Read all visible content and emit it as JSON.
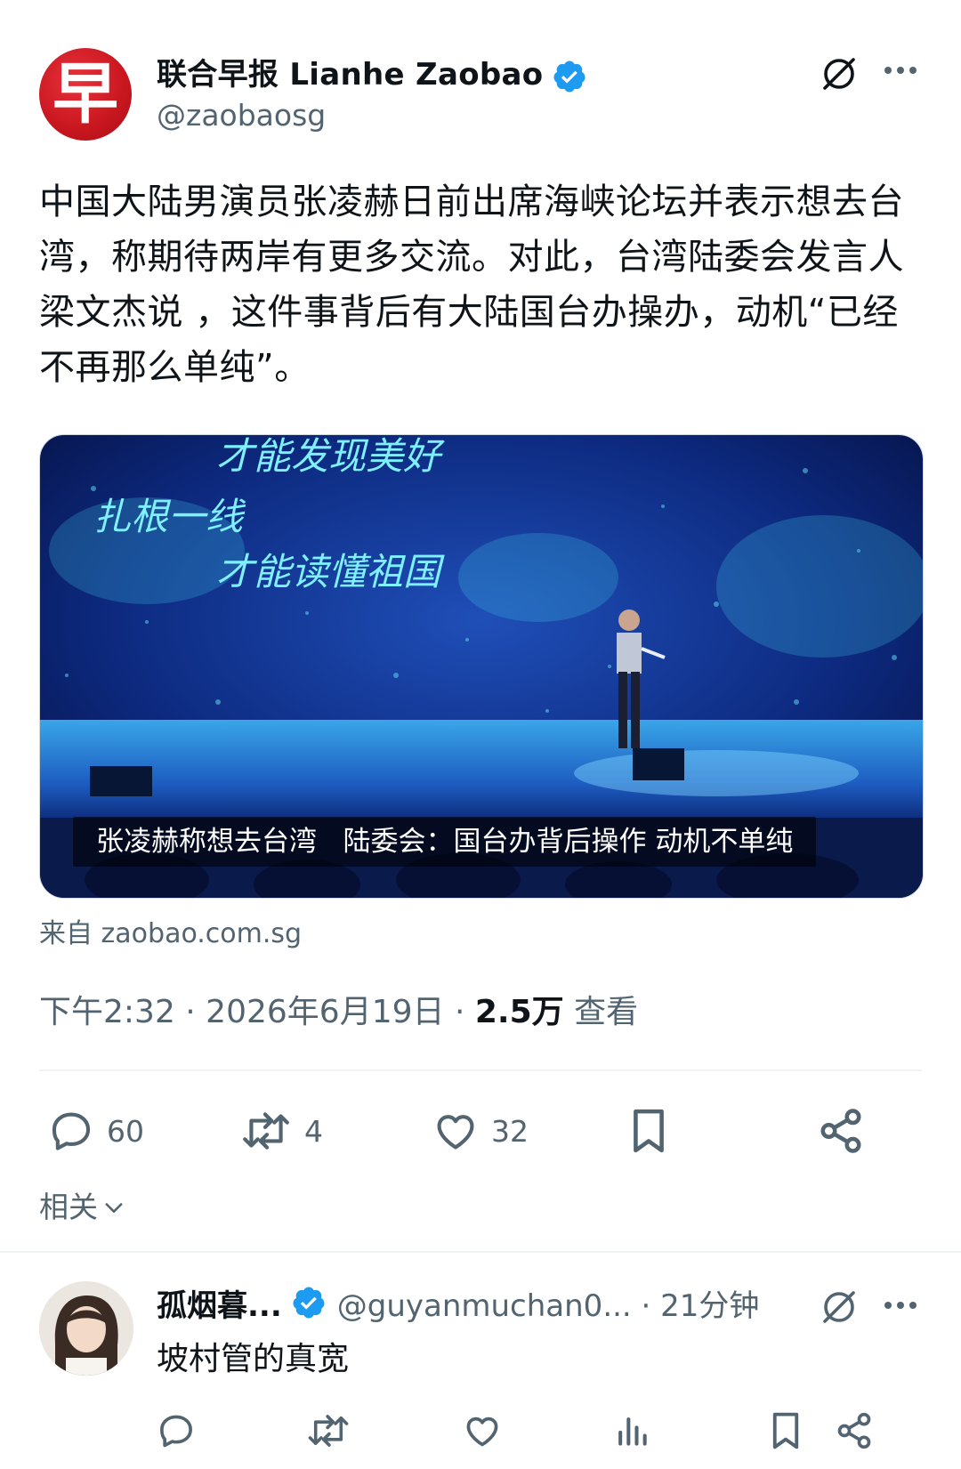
{
  "tweet": {
    "avatar_char": "早",
    "display_name": "联合早报 Lianhe Zaobao",
    "handle": "@zaobaosg",
    "text": "中国大陆男演员张凌赫日前出席海峡论坛并表示想去台湾，称期待两岸有更多交流。对此，台湾陆委会发言人梁文杰说 ，这件事背后有大陆国台办操办，动机“已经不再那么单纯”。",
    "media": {
      "screen_text_line1": "才能发现美好",
      "screen_text_line2": "扎根一线",
      "screen_text_line3": "才能读懂祖国",
      "caption": "张凌赫称想去台湾   陆委会：国台办背后操作 动机不单纯"
    },
    "source_label": "来自 zaobao.com.sg",
    "time": "下午2:32 · 2026年6月19日 · ",
    "views_count": "2.5万",
    "views_label": " 查看",
    "actions": {
      "reply_count": "60",
      "retweet_count": "4",
      "like_count": "32"
    },
    "related_label": "相关"
  },
  "reply": {
    "display_name": "孤烟暮...",
    "handle": "@guyanmuchan0... · 21分钟",
    "text": "坡村管的真宽"
  },
  "colors": {
    "verified": "#1d9bf0",
    "secondary_text": "#536471",
    "logo_red": "#c8161f"
  },
  "icons": [
    "verified-badge-icon",
    "grok-icon",
    "more-icon",
    "reply-icon",
    "retweet-icon",
    "like-icon",
    "bookmark-icon",
    "share-icon",
    "chevron-down-icon",
    "views-icon"
  ]
}
